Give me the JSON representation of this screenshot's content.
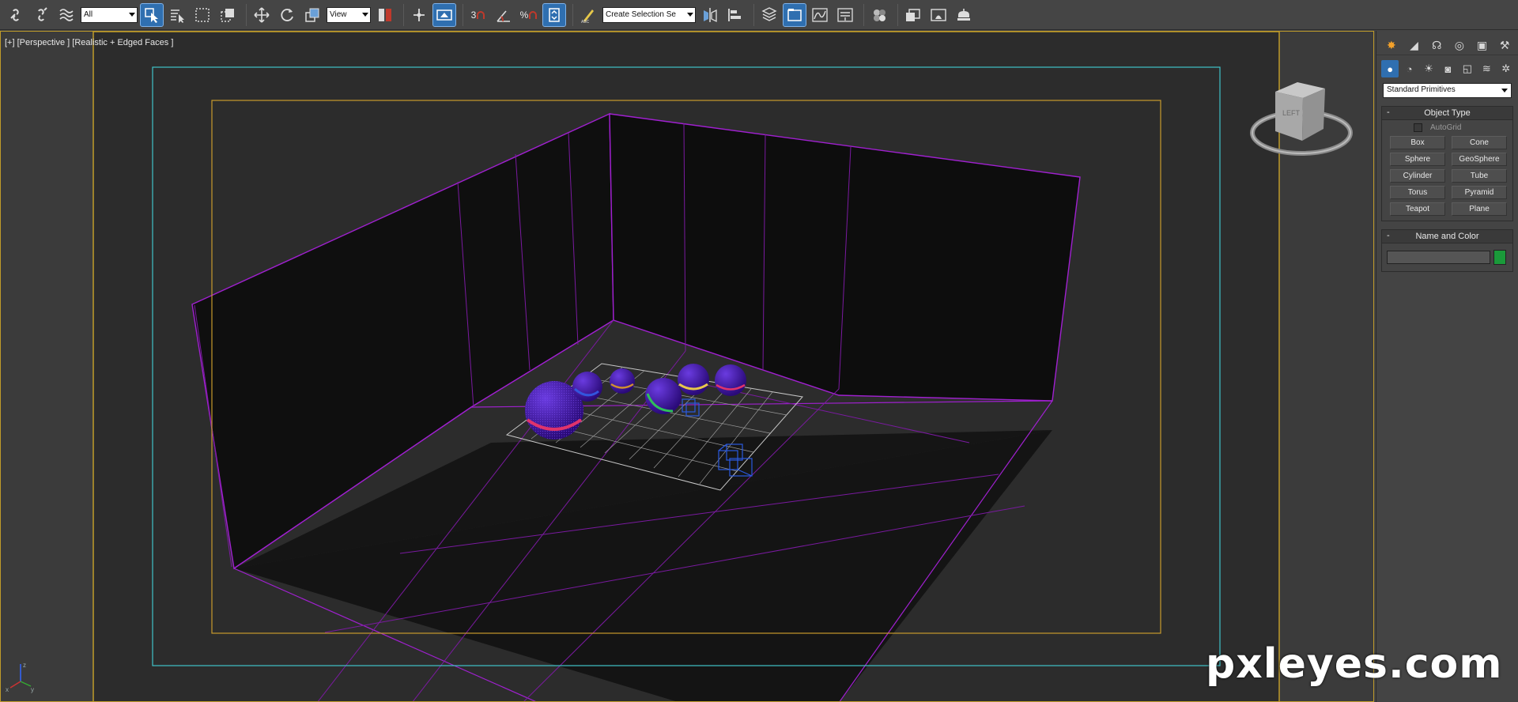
{
  "toolbar": {
    "selection_filter": "All",
    "reference_coord": "View",
    "angle_snap_label": "3",
    "percent_snap_label": "%",
    "named_selection_placeholder": "Create Selection Se"
  },
  "viewport": {
    "label": "[+] [Perspective ] [Realistic + Edged Faces ]",
    "viewcube_label": "LEFT",
    "axis_labels": {
      "x": "x",
      "y": "y",
      "z": "z"
    }
  },
  "command_panel": {
    "category_dropdown": "Standard Primitives",
    "object_type": {
      "title": "Object Type",
      "autogrid": "AutoGrid",
      "buttons": [
        "Box",
        "Cone",
        "Sphere",
        "GeoSphere",
        "Cylinder",
        "Tube",
        "Torus",
        "Pyramid",
        "Teapot",
        "Plane"
      ]
    },
    "name_and_color": {
      "title": "Name and Color",
      "name_value": "",
      "swatch_color": "#1a9a3a"
    },
    "collapse_symbol": "-"
  },
  "colors": {
    "selection_highlight": "#2f6fb0",
    "safe_frame_outer": "#bf9b2a",
    "safe_frame_action": "#3fc3c8",
    "safe_frame_title": "#c79a2c",
    "wireframe_walls": "#a020d0",
    "spheres": "#4a18b8"
  },
  "watermark": "pxleyes.com"
}
